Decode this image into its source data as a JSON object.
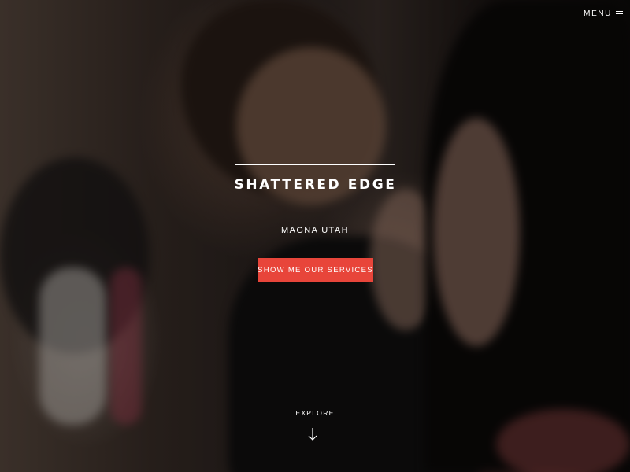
{
  "header": {
    "menu_label": "MENU",
    "menu_icon": "hamburger-icon"
  },
  "hero": {
    "title": "SHATTERED EDGE",
    "subtitle": "MAGNA UTAH",
    "cta_label": "SHOW ME OUR SERVICES",
    "explore_label": "EXPLORE",
    "explore_icon": "arrow-down-icon"
  },
  "colors": {
    "accent": "#e8453a",
    "text": "#ffffff"
  }
}
